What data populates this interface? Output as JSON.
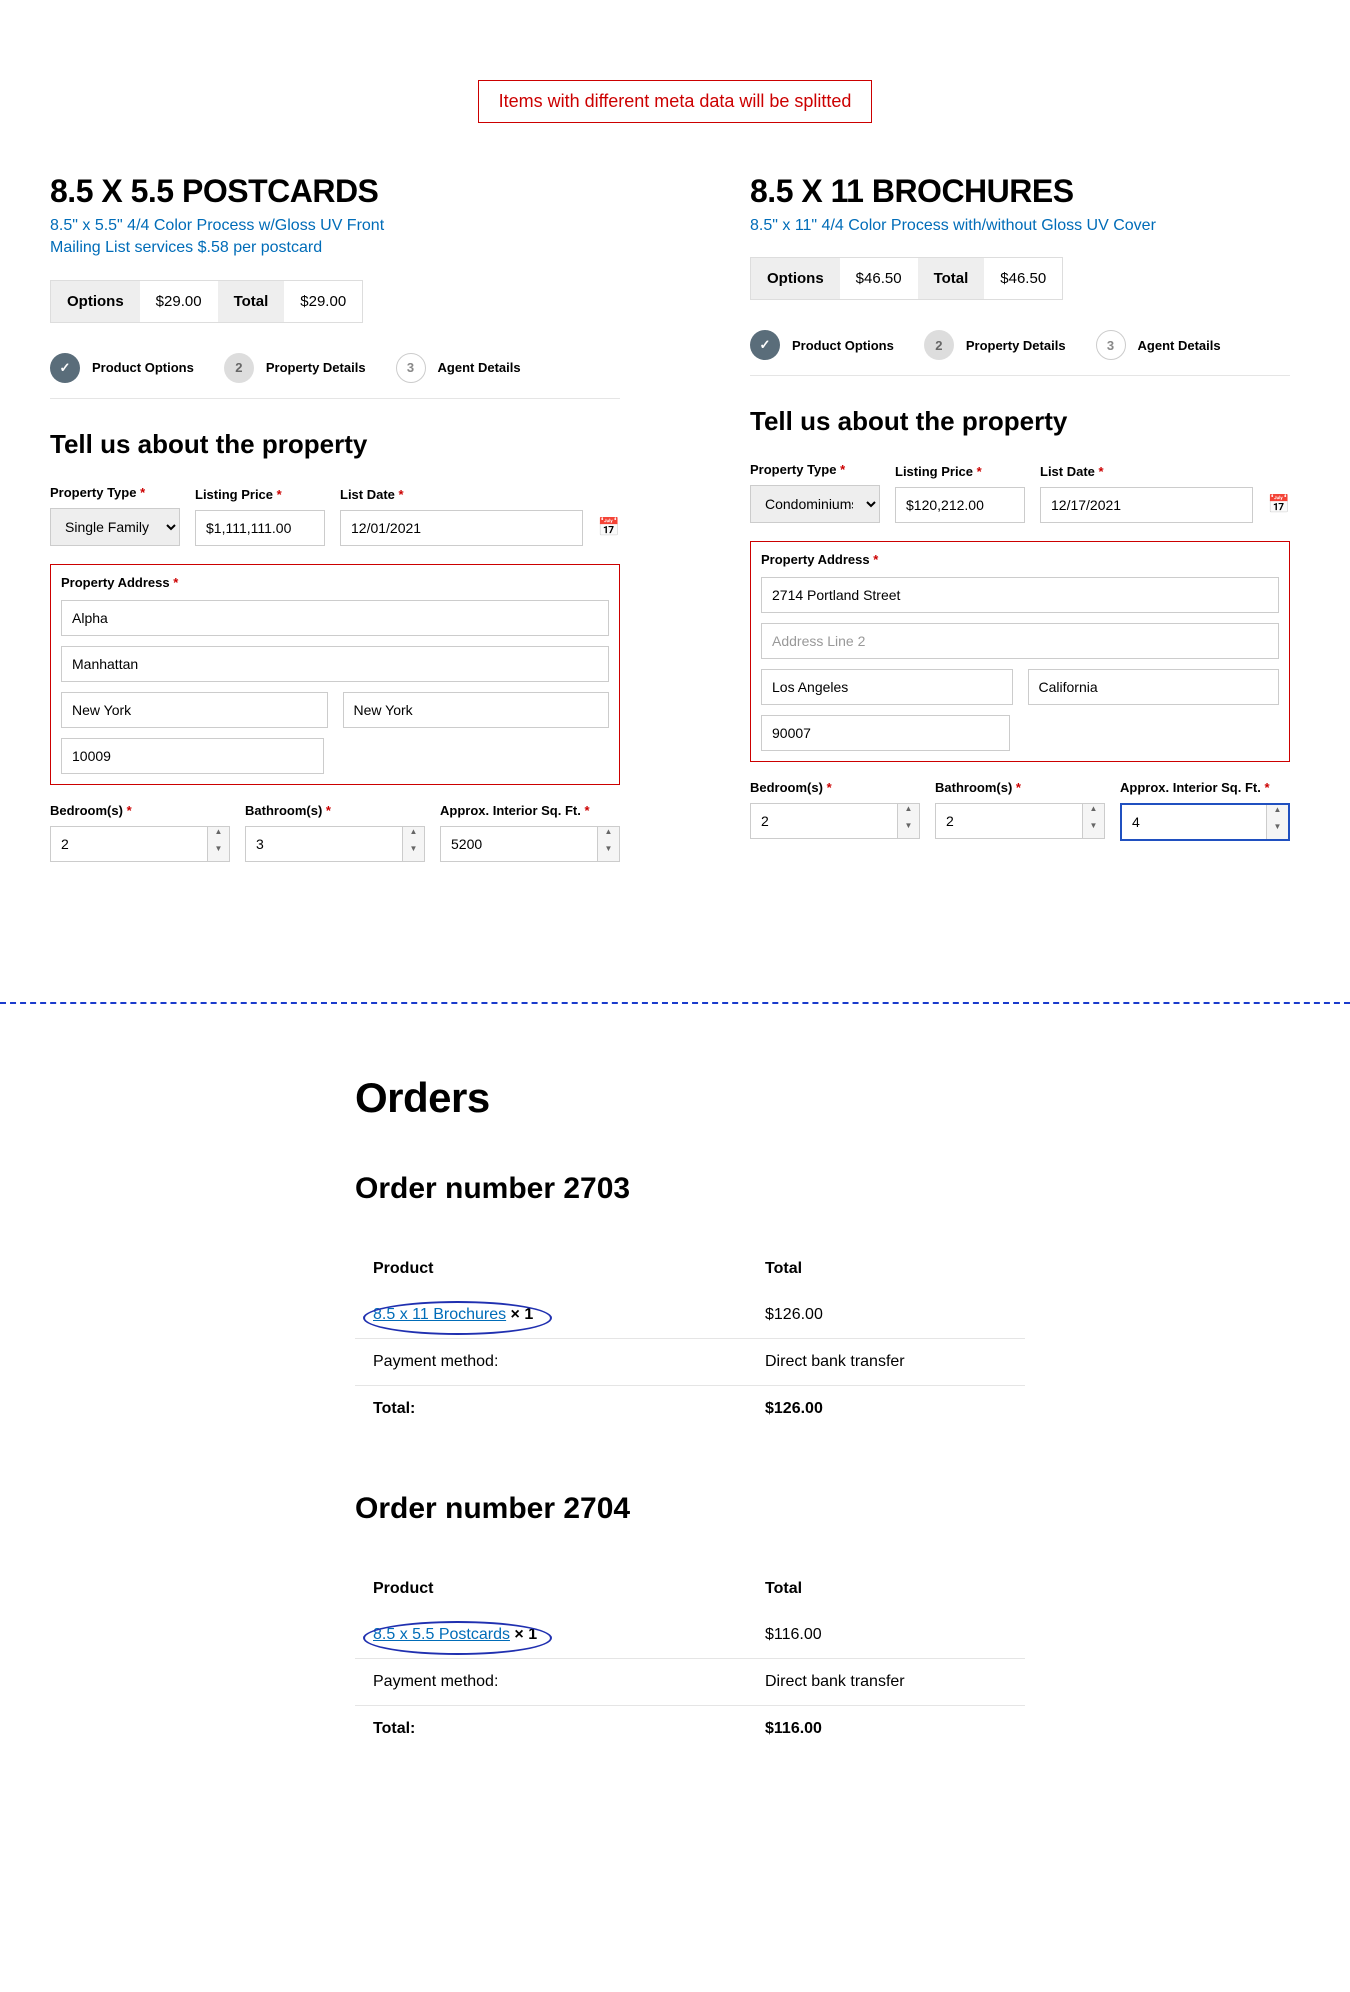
{
  "banner": "Items with different meta data will be splitted",
  "left": {
    "title": "8.5 X 5.5 POSTCARDS",
    "sub1": "8.5\" x 5.5\" 4/4 Color Process w/Gloss UV Front",
    "sub2": "Mailing List services $.58 per postcard",
    "options_label": "Options",
    "options_price": "$29.00",
    "total_label": "Total",
    "total_price": "$29.00",
    "step1": "Product Options",
    "step2": "Property Details",
    "step3": "Agent Details",
    "step2_num": "2",
    "step3_num": "3",
    "section_title": "Tell us about the property",
    "property_type_label": "Property Type",
    "property_type_value": "Single Family",
    "listing_price_label": "Listing Price",
    "listing_price_value": "$1,111,111.00",
    "list_date_label": "List Date",
    "list_date_value": "12/01/2021",
    "address_label": "Property Address",
    "addr1": "Alpha",
    "addr2": "Manhattan",
    "city": "New York",
    "state": "New York",
    "zip": "10009",
    "bedrooms_label": "Bedroom(s)",
    "bedrooms": "2",
    "bathrooms_label": "Bathroom(s)",
    "bathrooms": "3",
    "sqft_label": "Approx. Interior Sq. Ft.",
    "sqft": "5200"
  },
  "right": {
    "title": "8.5 X 11 BROCHURES",
    "sub1": "8.5\" x 11\" 4/4 Color Process with/without Gloss UV Cover",
    "options_label": "Options",
    "options_price": "$46.50",
    "total_label": "Total",
    "total_price": "$46.50",
    "step1": "Product Options",
    "step2": "Property Details",
    "step3": "Agent Details",
    "step2_num": "2",
    "step3_num": "3",
    "section_title": "Tell us about the property",
    "property_type_label": "Property Type",
    "property_type_value": "Condominiums",
    "listing_price_label": "Listing Price",
    "listing_price_value": "$120,212.00",
    "list_date_label": "List Date",
    "list_date_value": "12/17/2021",
    "address_label": "Property Address",
    "addr1": "2714 Portland Street",
    "addr2_placeholder": "Address Line 2",
    "city": "Los Angeles",
    "state": "California",
    "zip": "90007",
    "bedrooms_label": "Bedroom(s)",
    "bedrooms": "2",
    "bathrooms_label": "Bathroom(s)",
    "bathrooms": "2",
    "sqft_label": "Approx. Interior Sq. Ft.",
    "sqft": "4"
  },
  "orders": {
    "heading": "Orders",
    "order1": {
      "title": "Order number 2703",
      "product_col": "Product",
      "total_col": "Total",
      "product_link": "8.5 x 11 Brochures",
      "qty": " × 1",
      "line_total": "$126.00",
      "payment_label": "Payment method:",
      "payment_value": "Direct bank transfer",
      "total_label": "Total:",
      "total_value": "$126.00"
    },
    "order2": {
      "title": "Order number 2704",
      "product_col": "Product",
      "total_col": "Total",
      "product_link": "8.5 x 5.5 Postcards",
      "qty": " × 1",
      "line_total": "$116.00",
      "payment_label": "Payment method:",
      "payment_value": "Direct bank transfer",
      "total_label": "Total:",
      "total_value": "$116.00"
    }
  }
}
